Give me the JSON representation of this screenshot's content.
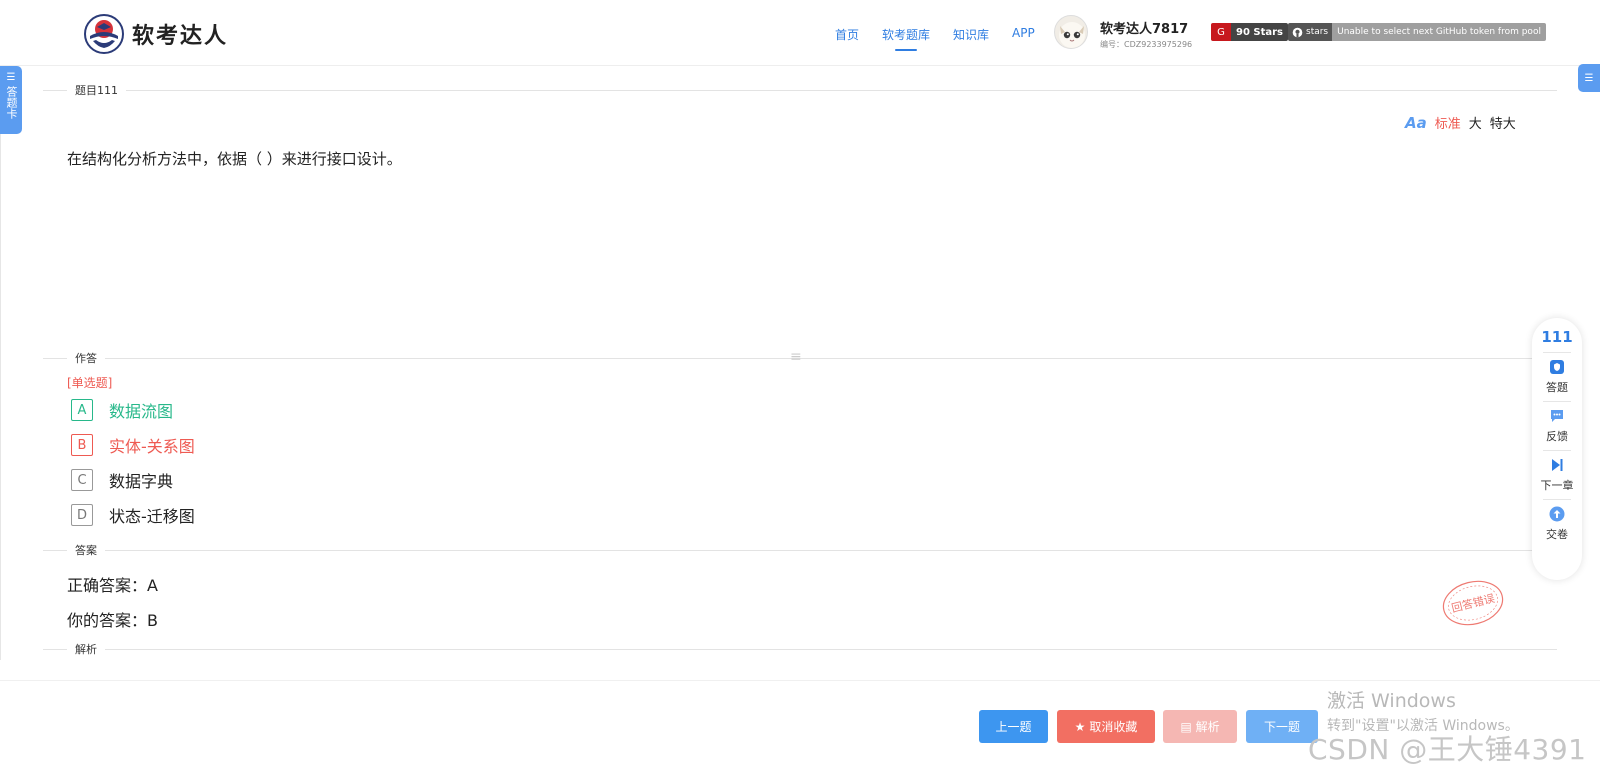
{
  "header": {
    "logo_text": "软考达人",
    "nav": [
      "首页",
      "软考题库",
      "知识库",
      "APP"
    ],
    "nav_active_index": 1,
    "user_name": "软考达人7817",
    "user_id": "编号：CDZ9233975296",
    "badge_g_label": "G",
    "badge_g_count": "90 Stars",
    "badge_gh_label": "stars",
    "badge_gh_msg": "Unable to select next GitHub token from pool"
  },
  "left_tab": {
    "label": "答题卡"
  },
  "sections": {
    "title": "题目111",
    "answer_area": "作答",
    "answer": "答案",
    "analysis": "解析"
  },
  "font_size": {
    "standard": "标准",
    "large": "大",
    "xlarge": "特大",
    "active": "standard"
  },
  "question": {
    "text": "在结构化分析方法中，依据（ ）来进行接口设计。",
    "type": "[单选题]"
  },
  "options": [
    {
      "key": "A",
      "text": "数据流图",
      "state": "correct"
    },
    {
      "key": "B",
      "text": "实体-关系图",
      "state": "wrong"
    },
    {
      "key": "C",
      "text": "数据字典",
      "state": "normal"
    },
    {
      "key": "D",
      "text": "状态-迁移图",
      "state": "normal"
    }
  ],
  "answer": {
    "correct": "正确答案：A",
    "yours": "你的答案：B",
    "stamp": "回答错误"
  },
  "float_panel": {
    "number": "111",
    "items": [
      {
        "label": "答题",
        "icon": "shield-icon"
      },
      {
        "label": "反馈",
        "icon": "chat-icon"
      },
      {
        "label": "下一章",
        "icon": "skip-next-icon"
      },
      {
        "label": "交卷",
        "icon": "upload-icon"
      }
    ]
  },
  "buttons": {
    "prev": "上一题",
    "fav": "取消收藏",
    "analysis": "解析",
    "next": "下一题"
  },
  "watermark": {
    "line1": "激活 Windows",
    "line2": "转到\"设置\"以激活 Windows。",
    "csdn": "CSDN @王大锤4391"
  },
  "colors": {
    "accent": "#2f7de1",
    "correct": "#27b88a",
    "wrong": "#ee5a52"
  }
}
